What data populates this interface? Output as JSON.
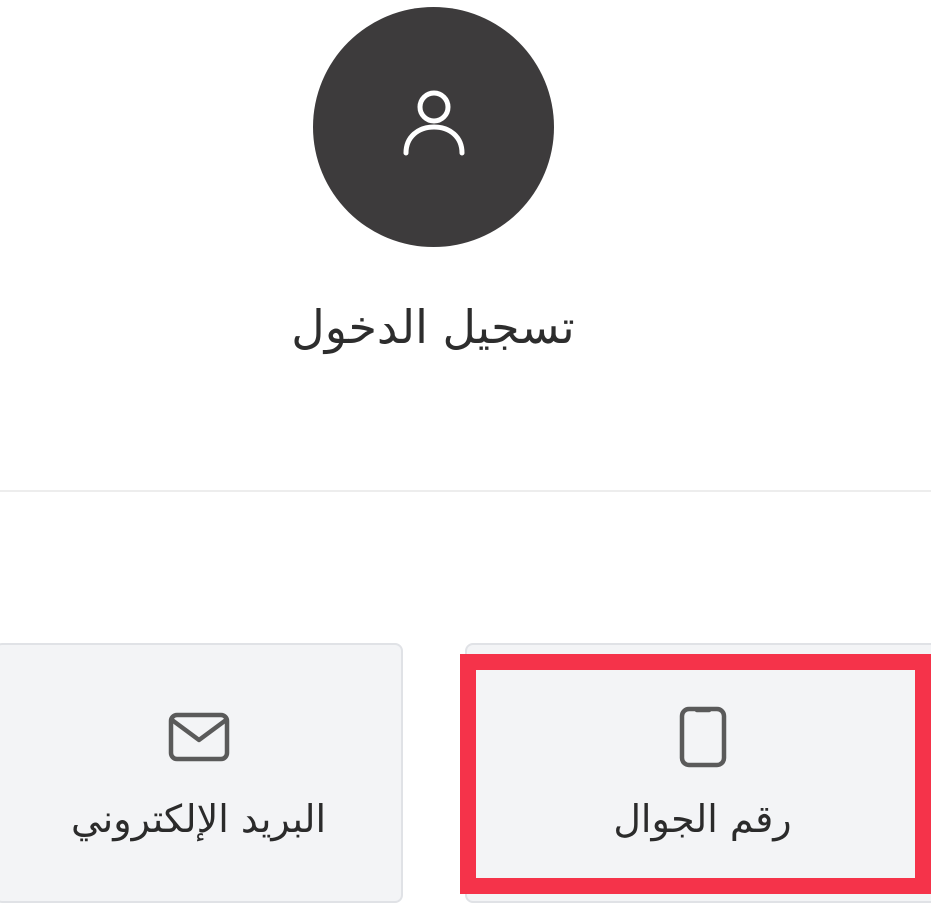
{
  "header": {
    "avatar_icon": "user-icon",
    "title": "تسجيل الدخول"
  },
  "login_options": [
    {
      "label": "البريد الإلكتروني",
      "icon": "envelope-icon"
    },
    {
      "label": "رقم الجوال",
      "icon": "mobile-phone-icon",
      "highlighted": true
    }
  ],
  "colors": {
    "avatar_bg": "#3d3b3c",
    "option_bg": "#f3f4f6",
    "highlight_border": "#f5334a"
  }
}
